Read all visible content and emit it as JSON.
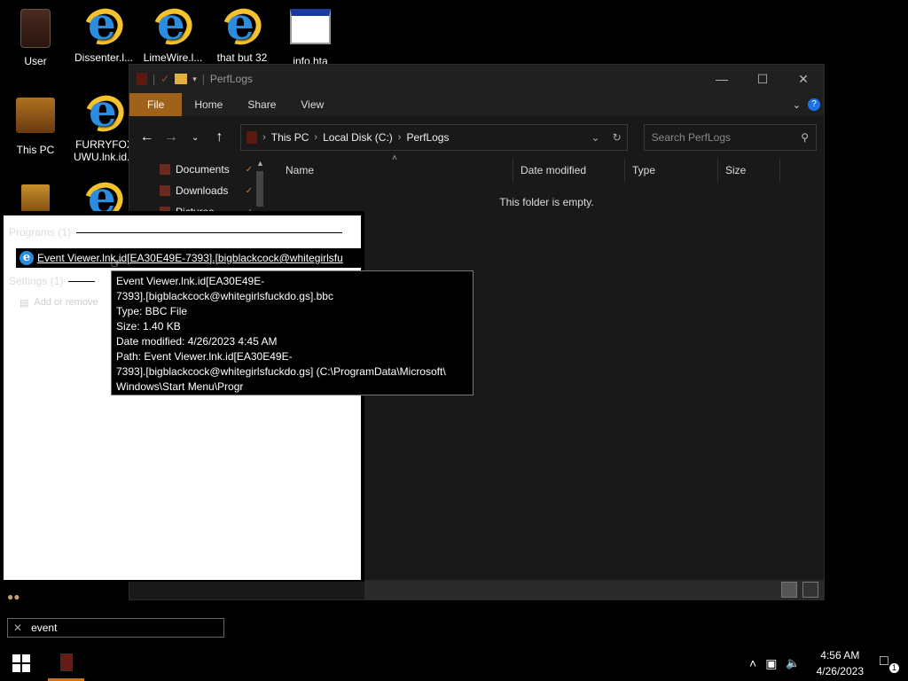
{
  "desktop": {
    "icons": [
      {
        "label": "User"
      },
      {
        "label": "Dissenter.l..."
      },
      {
        "label": "LimeWire.l..."
      },
      {
        "label": "that but 32"
      },
      {
        "label": "info.hta"
      },
      {
        "label": "This PC"
      },
      {
        "label": "FURRYFOX UWU.lnk.id..."
      }
    ]
  },
  "explorer": {
    "title": "PerfLogs",
    "tabs": [
      "File",
      "Home",
      "Share",
      "View"
    ],
    "breadcrumb": [
      "This PC",
      "Local Disk (C:)",
      "PerfLogs"
    ],
    "search_placeholder": "Search PerfLogs",
    "nav_items": [
      "Documents",
      "Downloads",
      "Pictures"
    ],
    "columns": [
      "Name",
      "Date modified",
      "Type",
      "Size"
    ],
    "empty_message": "This folder is empty."
  },
  "search_panel": {
    "programs_header": "Programs (1)",
    "result_label": "Event Viewer.lnk.id[EA30E49E-7393].[bigblackcock@whitegirlsfu",
    "settings_header": "Settings (1)",
    "settings_item": "Add or remove"
  },
  "tooltip": {
    "line1": "Event Viewer.lnk.id[EA30E49E-",
    "line2": "7393].[bigblackcock@whitegirlsfuckdo.gs].bbc",
    "line3": "Type: BBC File",
    "line4": "Size: 1.40 KB",
    "line5": "Date modified: 4/26/2023 4:45 AM",
    "line6": "Path: Event Viewer.lnk.id[EA30E49E-",
    "line7": "7393].[bigblackcock@whitegirlsfuckdo.gs] (C:\\ProgramData\\Microsoft\\",
    "line8": "Windows\\Start Menu\\Progr"
  },
  "search_box": {
    "value": "event"
  },
  "taskbar": {
    "time": "4:56 AM",
    "date": "4/26/2023",
    "notification_count": "1"
  }
}
